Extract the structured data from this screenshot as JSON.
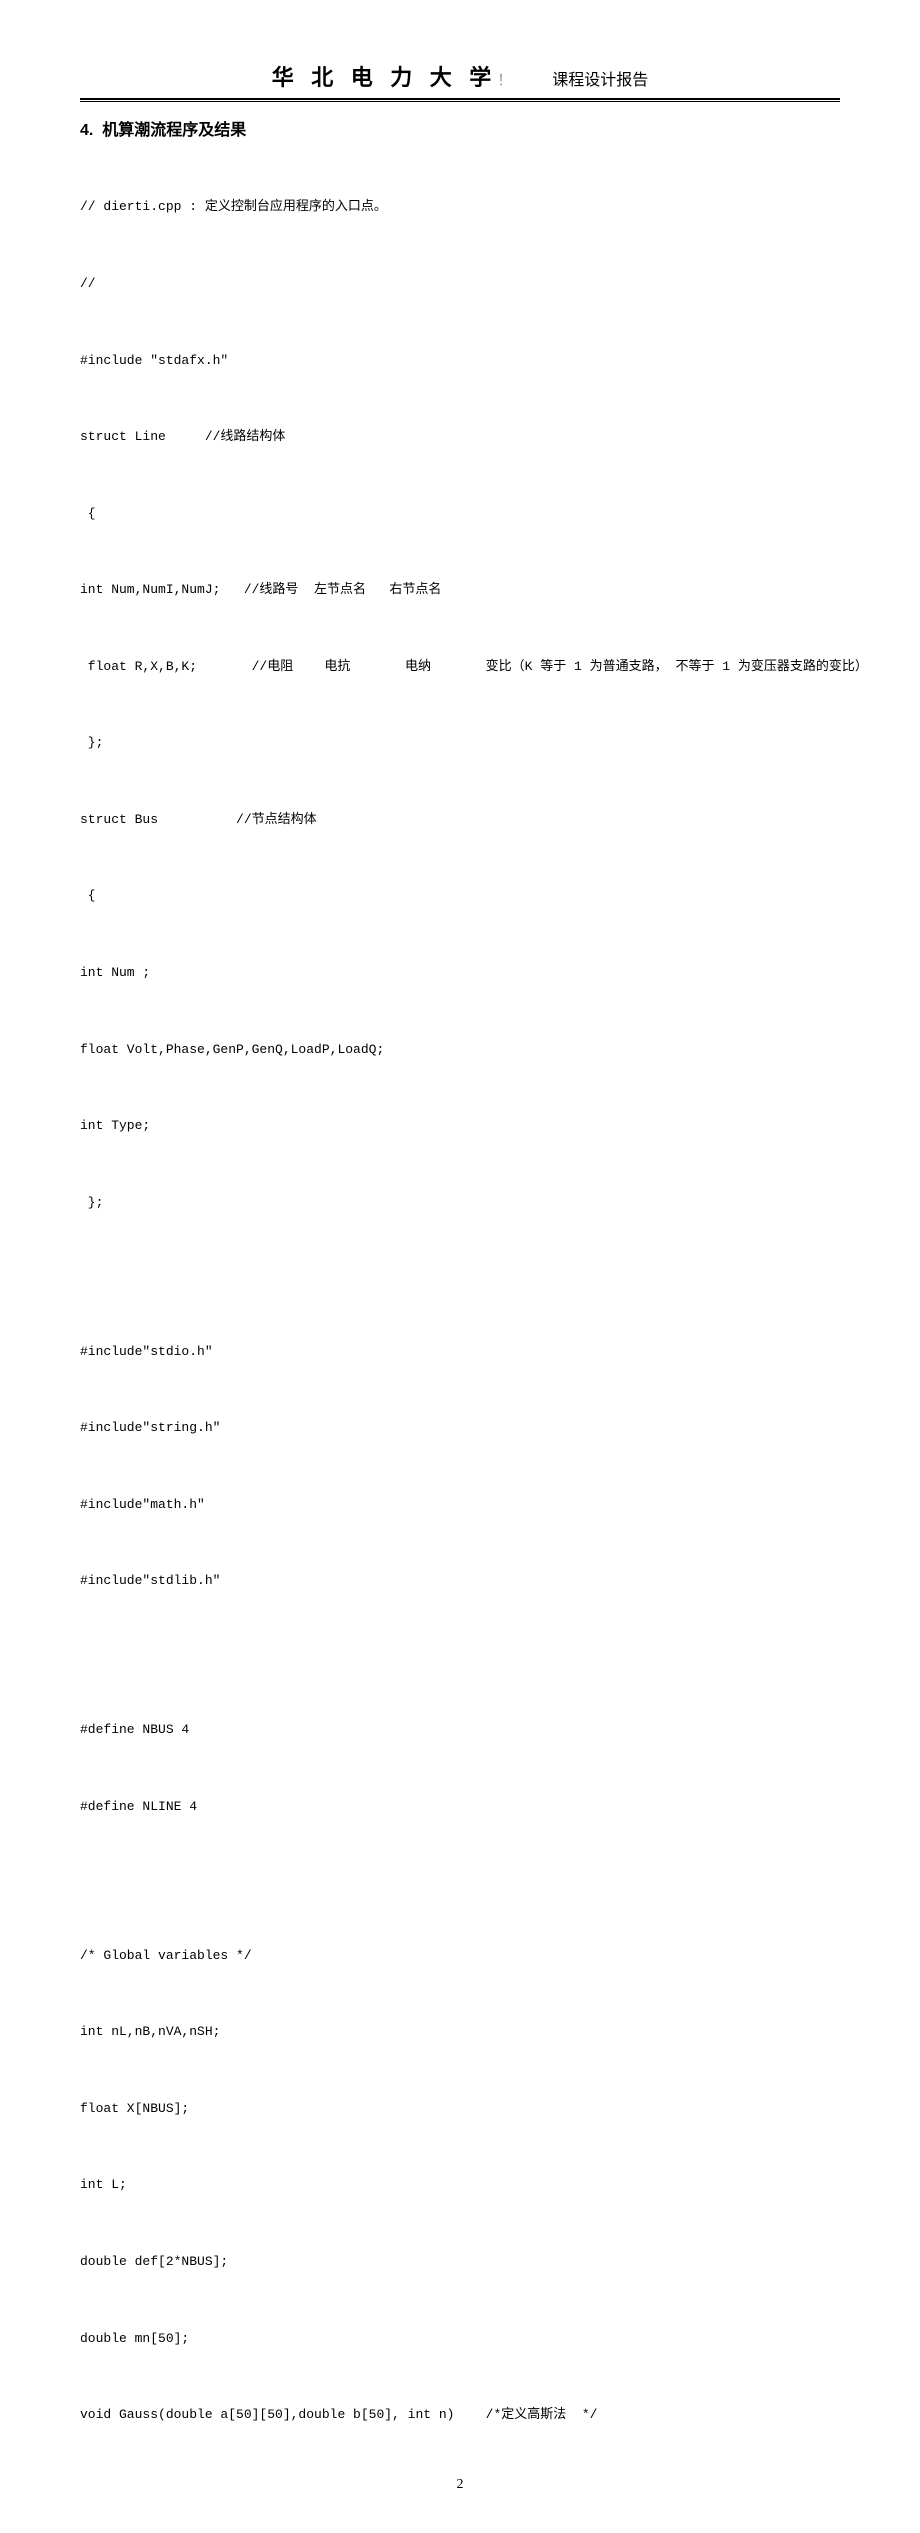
{
  "header": {
    "university": "华 北 电 力 大 学",
    "bangs": "！",
    "subtitle": "课程设计报告"
  },
  "section": {
    "number": "4.",
    "title": "机算潮流程序及结果"
  },
  "code_lines": [
    "// dierti.cpp : 定义控制台应用程序的入口点。",
    "//",
    "#include \"stdafx.h\"",
    "struct Line     //线路结构体",
    " {",
    "int Num,NumI,NumJ;   //线路号  左节点名   右节点名",
    " float R,X,B,K;       //电阻    电抗       电纳       变比（K 等于 1 为普通支路， 不等于 1 为变压器支路的变比）",
    " };",
    "struct Bus          //节点结构体",
    " {",
    "int Num ;",
    "float Volt,Phase,GenP,GenQ,LoadP,LoadQ;",
    "int Type;",
    " };",
    "",
    "#include\"stdio.h\"",
    "#include\"string.h\"",
    "#include\"math.h\"",
    "#include\"stdlib.h\"",
    "",
    "#define NBUS 4",
    "#define NLINE 4",
    "",
    "/* Global variables */",
    "int nL,nB,nVA,nSH;",
    "float X[NBUS];",
    "int L;",
    "double def[2*NBUS];",
    "double mn[50];",
    "void Gauss(double a[50][50],double b[50], int n)    /*定义高斯法  */"
  ],
  "page_number": "2"
}
